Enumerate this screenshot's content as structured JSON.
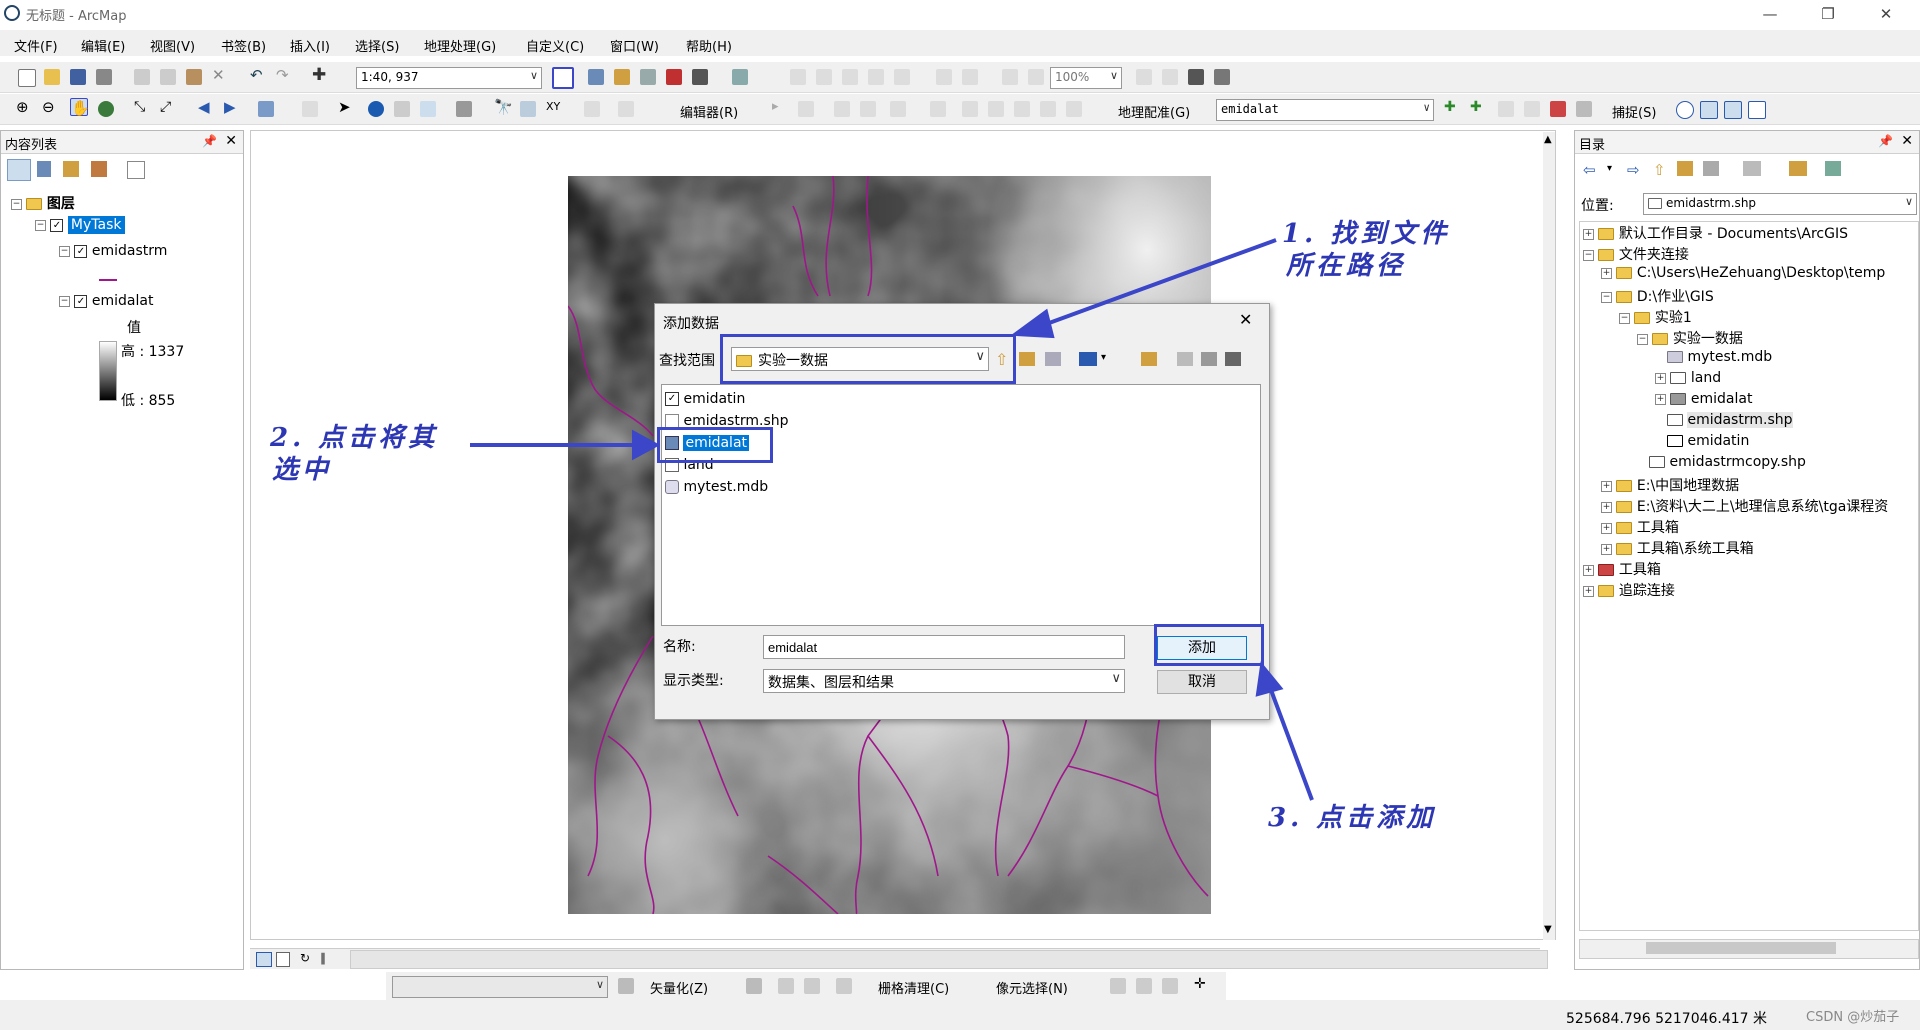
{
  "window": {
    "title": "无标题 - ArcMap",
    "controls": [
      "—",
      "❐",
      "✕"
    ]
  },
  "menubar": [
    "文件(F)",
    "编辑(E)",
    "视图(V)",
    "书签(B)",
    "插入(I)",
    "选择(S)",
    "地理处理(G)",
    "自定义(C)",
    "窗口(W)",
    "帮助(H)"
  ],
  "toolbar1": {
    "scale": "1:40, 937",
    "zoom": "100%"
  },
  "toolbar2": {
    "editor": "编辑器(R)",
    "georef": "地理配准(G)",
    "georef_layer": "emidalat",
    "snapping": "捕捉(S)"
  },
  "toc": {
    "title": "内容列表",
    "layers_label": "图层",
    "dataframe": "MyTask",
    "layer1": "emidastrm",
    "layer2": "emidalat",
    "value_label": "值",
    "high": "高 : 1337",
    "low": "低 : 855"
  },
  "catalog": {
    "title": "目录",
    "location_label": "位置:",
    "location_value": "emidastrm.shp",
    "items": [
      "默认工作目录 - Documents\\ArcGIS",
      "文件夹连接",
      "C:\\Users\\HeZehuang\\Desktop\\temp",
      "D:\\作业\\GIS",
      "实验1",
      "实验一数据",
      "mytest.mdb",
      "land",
      "emidalat",
      "emidastrm.shp",
      "emidatin",
      "emidastrmcopy.shp",
      "E:\\中国地理数据",
      "E:\\资料\\大二上\\地理信息系统\\tga课程资",
      "工具箱",
      "工具箱\\系统工具箱",
      "工具箱",
      "追踪连接"
    ]
  },
  "dialog": {
    "title": "添加数据",
    "look_in_label": "查找范围",
    "look_in_value": "实验一数据",
    "files": [
      "emidatin",
      "emidastrm.shp",
      "emidalat",
      "land",
      "mytest.mdb"
    ],
    "name_label": "名称:",
    "name_value": "emidalat",
    "type_label": "显示类型:",
    "type_value": "数据集、图层和结果",
    "add_button": "添加",
    "cancel_button": "取消"
  },
  "annotations": {
    "step1_line1": "1. 找到文件",
    "step1_line2": "所在路径",
    "step2_line1": "2. 点击将其",
    "step2_line2": "选中",
    "step3": "3. 点击添加"
  },
  "bottom_toolbar": {
    "vectorize": "矢量化(Z)",
    "raster_cleanup": "栅格清理(C)",
    "cell_select": "像元选择(N)"
  },
  "status": {
    "coords": "525684.796  5217046.417 米",
    "watermark": "CSDN @炒茄子"
  },
  "colors": {
    "annotation": "#2d37b4",
    "stream": "#a0168c",
    "selection": "#0078d7"
  }
}
